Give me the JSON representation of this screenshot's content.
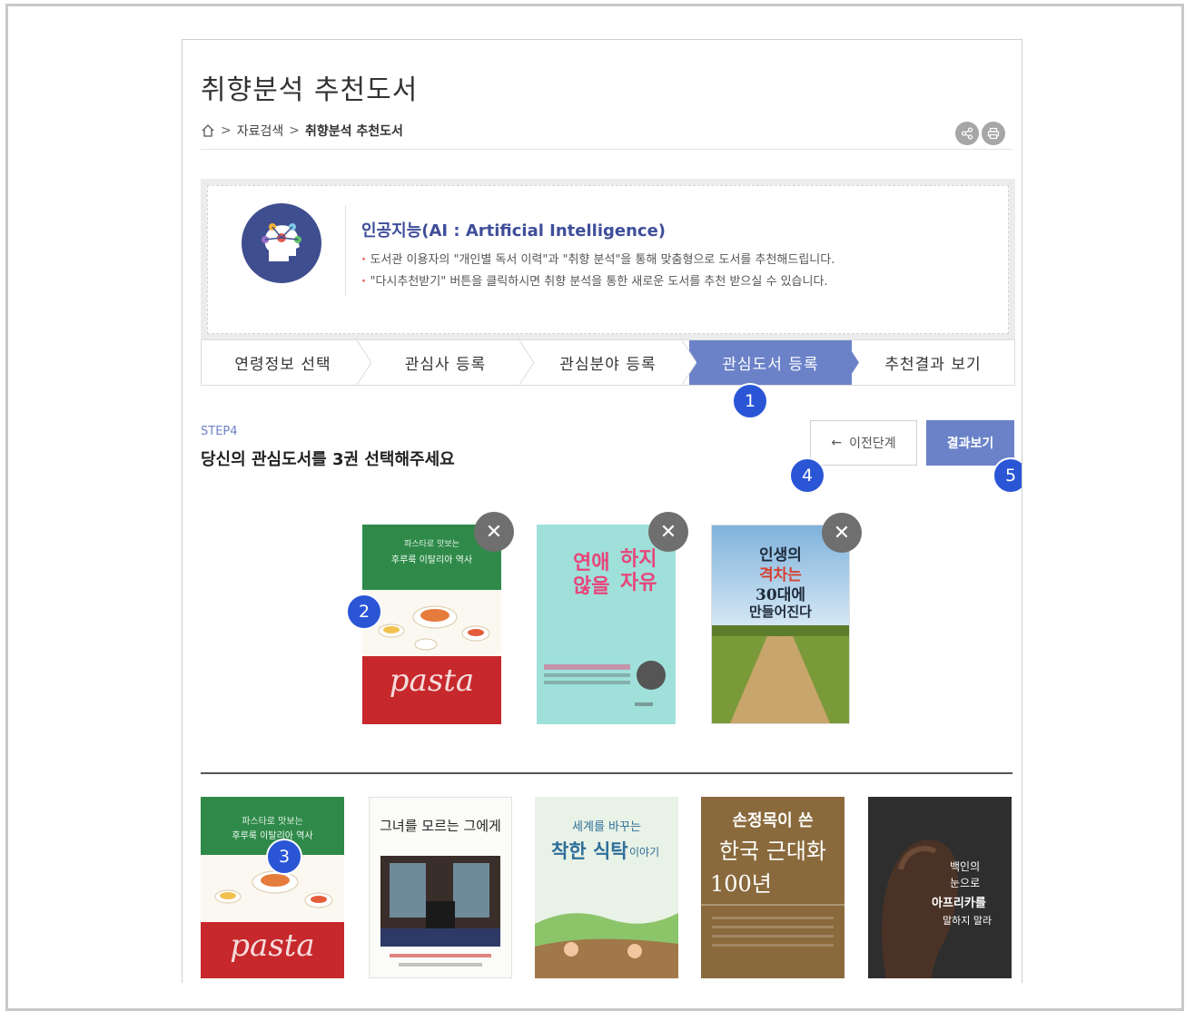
{
  "page": {
    "title": "취향분석 추천도서"
  },
  "breadcrumb": {
    "home_icon": "home-icon",
    "sep1": ">",
    "item1": "자료검색",
    "sep2": ">",
    "current": "취향분석 추천도서"
  },
  "tools": {
    "share_icon": "share-icon",
    "print_icon": "print-icon"
  },
  "ai_intro": {
    "icon": "ai-head-icon",
    "title": "인공지능(AI : Artificial Intelligence)",
    "lines": [
      "도서관 이용자의 \"개인별 독서 이력\"과 \"취향 분석\"을 통해 맞춤형으로 도서를 추천해드립니다.",
      "\"다시추천받기\" 버튼을 클릭하시면 취향 분석을 통한 새로운 도서를 추천 받으실 수 있습니다."
    ]
  },
  "steps": [
    {
      "label": "연령정보 선택",
      "active": false
    },
    {
      "label": "관심사 등록",
      "active": false
    },
    {
      "label": "관심분야 등록",
      "active": false
    },
    {
      "label": "관심도서 등록",
      "active": true
    },
    {
      "label": "추천결과 보기",
      "active": false
    }
  ],
  "step_info": {
    "label": "STEP4",
    "question": "당신의 관심도서를 3권 선택해주세요"
  },
  "buttons": {
    "prev_arrow": "←",
    "prev_label": "이전단계",
    "result_label": "결과보기"
  },
  "badges": [
    "1",
    "2",
    "3",
    "4",
    "5"
  ],
  "selected_books": [
    {
      "cover_top": "파스타로 맛보는",
      "cover_sub": "후루룩 이탈리아 역사",
      "cover_script": "pasta",
      "colors": {
        "top": "#2f8a4a",
        "bottom": "#c7282c"
      }
    },
    {
      "cover_top": "연애",
      "cover_top2": "하지",
      "cover_mid": "않을",
      "cover_mid2": "자유",
      "colors": {
        "bg": "#9fe0da",
        "accent": "#e8457a"
      }
    },
    {
      "cover_top": "인생의",
      "cover_mid": "격차는",
      "cover_bottom": "30대에",
      "cover_last": "만들어진다",
      "colors": {
        "sky": "#a9cfe9",
        "field": "#7a9a3a"
      }
    }
  ],
  "remove_label": "✕",
  "book_list": [
    {
      "cover_top": "파스타로 맛보는",
      "cover_sub": "후루룩 이탈리아 역사",
      "cover_script": "pasta"
    },
    {
      "cover_top": "그녀를 모르는 그에게"
    },
    {
      "cover_top": "세계를 바꾸는",
      "cover_mid": "착한 식탁",
      "cover_end": "이야기"
    },
    {
      "cover_top": "손정목이 쓴",
      "cover_mid": "한국 근대화",
      "cover_bottom": "100년"
    },
    {
      "cover_top": "백인의",
      "cover_mid": "눈으로",
      "cover_bottom": "아프리카를",
      "cover_end": "말하지 말라"
    }
  ]
}
